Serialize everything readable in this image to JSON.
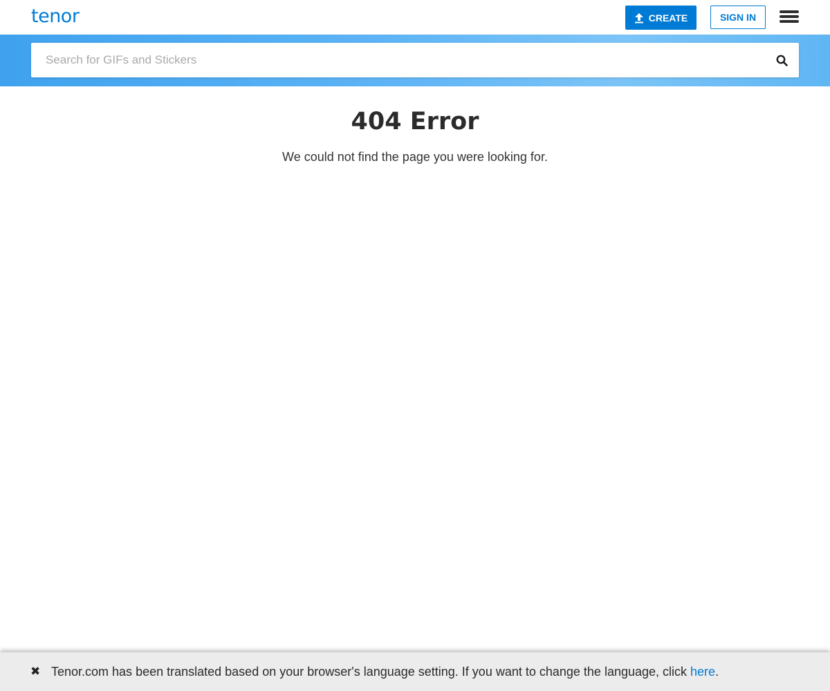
{
  "header": {
    "logo_text": "tenor",
    "create_label": "CREATE",
    "signin_label": "SIGN IN",
    "menu_icon": "hamburger-menu-icon"
  },
  "search": {
    "placeholder": "Search for GIFs and Stickers",
    "value": "",
    "icon": "search-icon"
  },
  "error": {
    "title": "404 Error",
    "message": "We could not find the page you were looking for."
  },
  "language_bar": {
    "close_glyph": "✖",
    "text": "Tenor.com has been translated based on your browser's language setting. If you want to change the language, click ",
    "link_label": "here",
    "trailing": "."
  },
  "colors": {
    "brand": "#007bd5",
    "search_band": "#5cb3f5",
    "lang_bar_bg": "#ececec"
  }
}
